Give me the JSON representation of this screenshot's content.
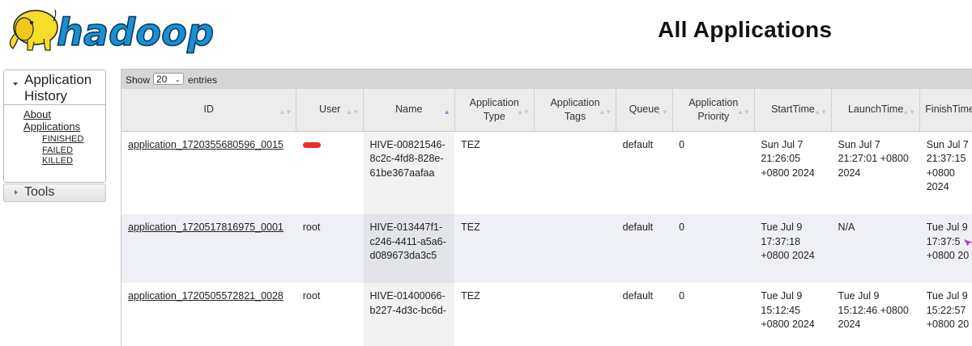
{
  "header": {
    "logo_text": "hadoop",
    "title": "All Applications"
  },
  "sidebar": {
    "section_label": "Application History",
    "links": [
      {
        "label": "About"
      },
      {
        "label": "Applications"
      }
    ],
    "sub_links": [
      {
        "label": "FINISHED"
      },
      {
        "label": "FAILED"
      },
      {
        "label": "KILLED"
      }
    ],
    "tools_label": "Tools"
  },
  "toolbar": {
    "show_label": "Show",
    "page_length": "20",
    "entries_label": "entries"
  },
  "table": {
    "columns": [
      {
        "label": "ID"
      },
      {
        "label": "User"
      },
      {
        "label": "Name"
      },
      {
        "label": "Application Type"
      },
      {
        "label": "Application Tags"
      },
      {
        "label": "Queue"
      },
      {
        "label": "Application Priority"
      },
      {
        "label": "StartTime"
      },
      {
        "label": "LaunchTime"
      },
      {
        "label": "FinishTime"
      }
    ],
    "rows": [
      {
        "id": "application_1720355680596_0015",
        "user": "",
        "name": "HIVE-00821546-8c2c-4fd8-828e-61be367aafaa",
        "type": "TEZ",
        "tags": "",
        "queue": "default",
        "priority": "0",
        "start": "Sun Jul 7 21:26:05 +0800 2024",
        "launch": "Sun Jul 7 21:27:01 +0800 2024",
        "finish": "Sun Jul 7 21:37:15 +0800 2024"
      },
      {
        "id": "application_1720517816975_0001",
        "user": "root",
        "name": "HIVE-013447f1-c246-4411-a5a6-d089673da3c5",
        "type": "TEZ",
        "tags": "",
        "queue": "default",
        "priority": "0",
        "start": "Tue Jul 9 17:37:18 +0800 2024",
        "launch": "N/A",
        "finish": "Tue Jul 9 17:37:5 +0800 20"
      },
      {
        "id": "application_1720505572821_0028",
        "user": "root",
        "name": "HIVE-01400066-b227-4d3c-bc6d-",
        "type": "TEZ",
        "tags": "",
        "queue": "default",
        "priority": "0",
        "start": "Tue Jul 9 15:12:45 +0800 2024",
        "launch": "Tue Jul 9 15:12:46 +0800 2024",
        "finish": "Tue Jul 9 15:22:57 +0800 20"
      }
    ]
  },
  "colors": {
    "accent_sort": "#7b8fd6",
    "redacted_user": "#e8302a",
    "logo_yellow": "#f7dc28",
    "logo_blue": "#1c8fcf"
  }
}
